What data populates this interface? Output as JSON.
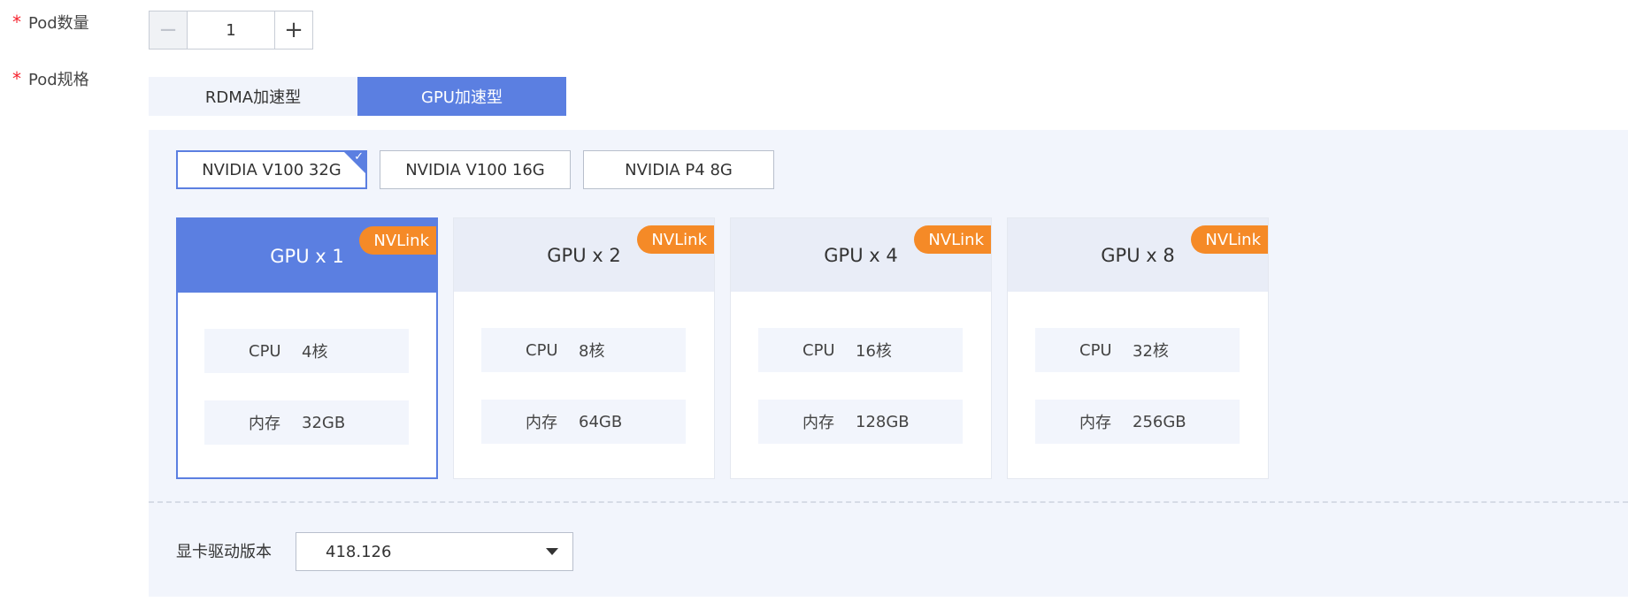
{
  "pod_count": {
    "label": "Pod数量",
    "required_mark": "*",
    "value": "1",
    "decrement_icon": "minus-icon",
    "increment_icon": "plus-icon"
  },
  "pod_spec": {
    "label": "Pod规格",
    "required_mark": "*",
    "tabs": [
      {
        "label": "RDMA加速型",
        "active": false
      },
      {
        "label": "GPU加速型",
        "active": true
      }
    ]
  },
  "gpu_types": [
    {
      "label": "NVIDIA V100 32G",
      "selected": true
    },
    {
      "label": "NVIDIA V100 16G",
      "selected": false
    },
    {
      "label": "NVIDIA P4 8G",
      "selected": false
    }
  ],
  "gpu_options": [
    {
      "title": "GPU x 1",
      "badge": "NVLink",
      "cpu_label": "CPU",
      "cpu_value": "4核",
      "mem_label": "内存",
      "mem_value": "32GB",
      "selected": true
    },
    {
      "title": "GPU x 2",
      "badge": "NVLink",
      "cpu_label": "CPU",
      "cpu_value": "8核",
      "mem_label": "内存",
      "mem_value": "64GB",
      "selected": false
    },
    {
      "title": "GPU x 4",
      "badge": "NVLink",
      "cpu_label": "CPU",
      "cpu_value": "16核",
      "mem_label": "内存",
      "mem_value": "128GB",
      "selected": false
    },
    {
      "title": "GPU x 8",
      "badge": "NVLink",
      "cpu_label": "CPU",
      "cpu_value": "32核",
      "mem_label": "内存",
      "mem_value": "256GB",
      "selected": false
    }
  ],
  "driver": {
    "label": "显卡驱动版本",
    "value": "418.126",
    "icon": "caret-down-icon"
  },
  "colors": {
    "accent": "#5b7fe1",
    "badge": "#f58a27",
    "required": "#f5222d",
    "panel_bg": "#f2f5fc"
  }
}
